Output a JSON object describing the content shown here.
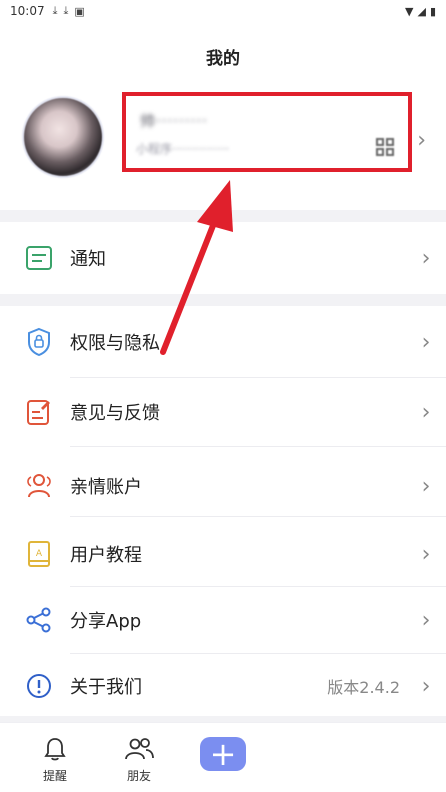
{
  "status_bar": {
    "time": "10:07"
  },
  "page": {
    "title": "我的"
  },
  "profile": {
    "name": "帅·········",
    "subtitle": "小程序···············"
  },
  "menu": {
    "notify": {
      "label": "通知"
    },
    "permission": {
      "label": "权限与隐私"
    },
    "feedback": {
      "label": "意见与反馈"
    },
    "family": {
      "label": "亲情账户"
    },
    "tutorial": {
      "label": "用户教程"
    },
    "share": {
      "label": "分享App"
    },
    "about": {
      "label": "关于我们",
      "value": "版本2.4.2"
    }
  },
  "bottom_nav": {
    "remind": "提醒",
    "friends": "朋友"
  },
  "colors": {
    "accent": "#7b8ef0",
    "highlight_red": "#e0202c",
    "notify_icon": "#3aa36a",
    "permission_icon": "#4a8fe0",
    "feedback_icon": "#e0553a",
    "family_icon": "#e0553a",
    "tutorial_icon": "#e0b53a",
    "share_icon": "#3a6fd6",
    "about_icon": "#2f5fc8"
  }
}
